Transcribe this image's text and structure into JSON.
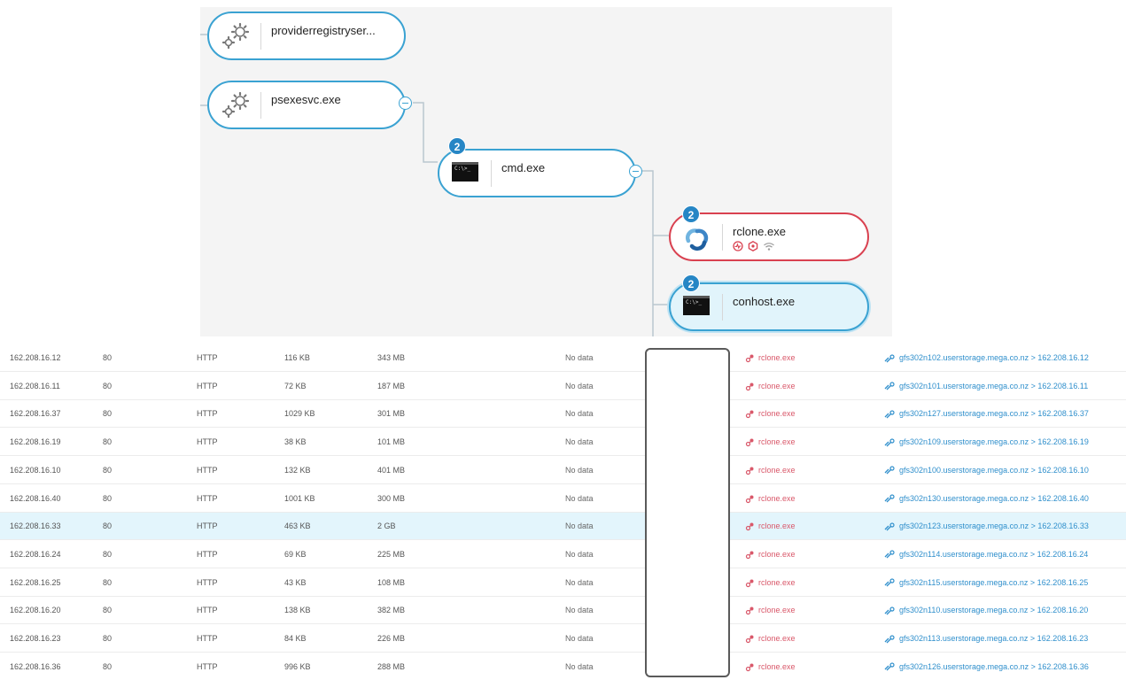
{
  "tree": {
    "nodes": {
      "providerregistry": {
        "label": "providerregistryser...",
        "icon": "gears-icon"
      },
      "psexesvc": {
        "label": "psexesvc.exe",
        "icon": "gears-icon"
      },
      "cmd": {
        "label": "cmd.exe",
        "icon": "terminal-icon",
        "badge": "2",
        "icon_text": "C:\\>_"
      },
      "rclone": {
        "label": "rclone.exe",
        "icon": "rclone-logo-icon",
        "badge": "2",
        "state": "alert",
        "indicators": [
          "pulse-icon",
          "hexagon-icon",
          "wifi-icon"
        ]
      },
      "conhost": {
        "label": "conhost.exe",
        "icon": "terminal-icon",
        "badge": "2",
        "state": "selected",
        "icon_text": "C:\\>_"
      }
    }
  },
  "table": {
    "rows": [
      {
        "ip": "162.208.16.12",
        "port": "80",
        "protocol": "HTTP",
        "sent": "116 KB",
        "received": "343 MB",
        "status": "No data",
        "process": "rclone.exe",
        "destination": "gfs302n102.userstorage.mega.co.nz > 162.208.16.12"
      },
      {
        "ip": "162.208.16.11",
        "port": "80",
        "protocol": "HTTP",
        "sent": "72 KB",
        "received": "187 MB",
        "status": "No data",
        "process": "rclone.exe",
        "destination": "gfs302n101.userstorage.mega.co.nz > 162.208.16.11"
      },
      {
        "ip": "162.208.16.37",
        "port": "80",
        "protocol": "HTTP",
        "sent": "1029 KB",
        "received": "301 MB",
        "status": "No data",
        "process": "rclone.exe",
        "destination": "gfs302n127.userstorage.mega.co.nz > 162.208.16.37"
      },
      {
        "ip": "162.208.16.19",
        "port": "80",
        "protocol": "HTTP",
        "sent": "38 KB",
        "received": "101 MB",
        "status": "No data",
        "process": "rclone.exe",
        "destination": "gfs302n109.userstorage.mega.co.nz > 162.208.16.19"
      },
      {
        "ip": "162.208.16.10",
        "port": "80",
        "protocol": "HTTP",
        "sent": "132 KB",
        "received": "401 MB",
        "status": "No data",
        "process": "rclone.exe",
        "destination": "gfs302n100.userstorage.mega.co.nz > 162.208.16.10"
      },
      {
        "ip": "162.208.16.40",
        "port": "80",
        "protocol": "HTTP",
        "sent": "1001 KB",
        "received": "300 MB",
        "status": "No data",
        "process": "rclone.exe",
        "destination": "gfs302n130.userstorage.mega.co.nz > 162.208.16.40"
      },
      {
        "ip": "162.208.16.33",
        "port": "80",
        "protocol": "HTTP",
        "sent": "463 KB",
        "received": "2 GB",
        "status": "No data",
        "process": "rclone.exe",
        "destination": "gfs302n123.userstorage.mega.co.nz > 162.208.16.33",
        "highlighted": true
      },
      {
        "ip": "162.208.16.24",
        "port": "80",
        "protocol": "HTTP",
        "sent": "69 KB",
        "received": "225 MB",
        "status": "No data",
        "process": "rclone.exe",
        "destination": "gfs302n114.userstorage.mega.co.nz > 162.208.16.24"
      },
      {
        "ip": "162.208.16.25",
        "port": "80",
        "protocol": "HTTP",
        "sent": "43 KB",
        "received": "108 MB",
        "status": "No data",
        "process": "rclone.exe",
        "destination": "gfs302n115.userstorage.mega.co.nz > 162.208.16.25"
      },
      {
        "ip": "162.208.16.20",
        "port": "80",
        "protocol": "HTTP",
        "sent": "138 KB",
        "received": "382 MB",
        "status": "No data",
        "process": "rclone.exe",
        "destination": "gfs302n110.userstorage.mega.co.nz > 162.208.16.20"
      },
      {
        "ip": "162.208.16.23",
        "port": "80",
        "protocol": "HTTP",
        "sent": "84 KB",
        "received": "226 MB",
        "status": "No data",
        "process": "rclone.exe",
        "destination": "gfs302n113.userstorage.mega.co.nz > 162.208.16.23"
      },
      {
        "ip": "162.208.16.36",
        "port": "80",
        "protocol": "HTTP",
        "sent": "996 KB",
        "received": "288 MB",
        "status": "No data",
        "process": "rclone.exe",
        "destination": "gfs302n126.userstorage.mega.co.nz > 162.208.16.36"
      }
    ]
  },
  "colors": {
    "node_border": "#3aa2d2",
    "alert_border": "#d94150",
    "badge": "#2686c5",
    "process_link": "#d9586a",
    "destination_link": "#2f8fcc",
    "highlight_row": "#e3f5fc"
  }
}
